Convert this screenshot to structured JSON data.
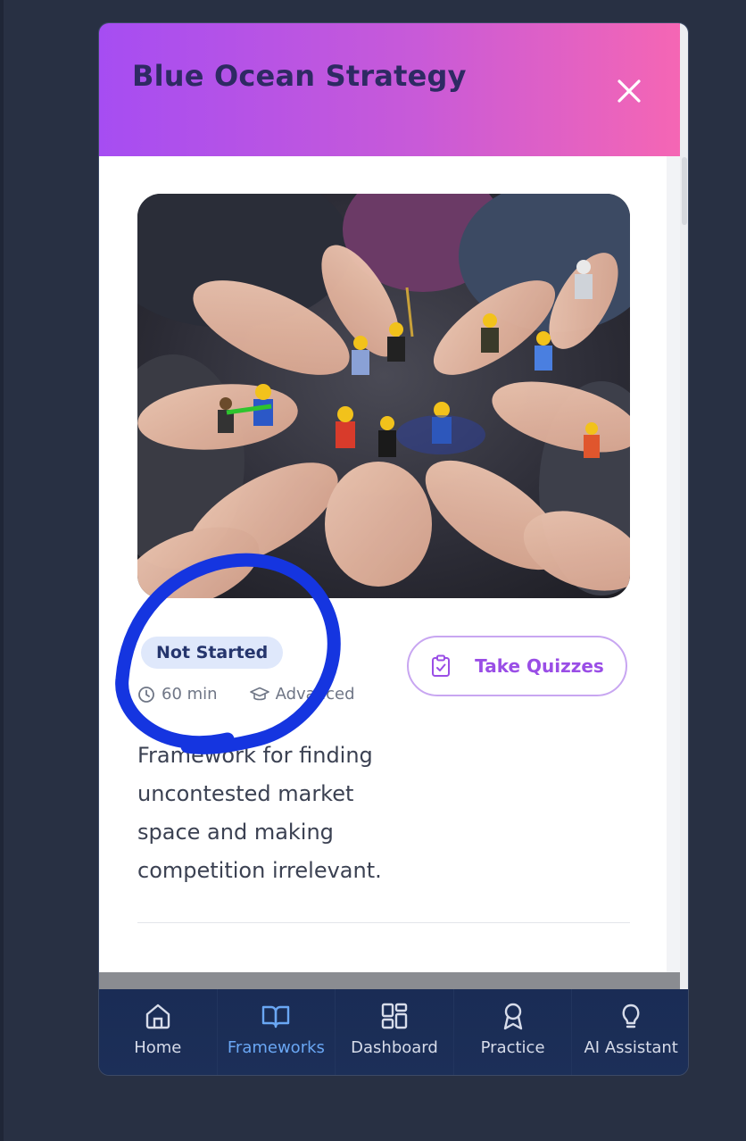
{
  "modal": {
    "title": "Blue Ocean Strategy",
    "close_icon": "close-icon"
  },
  "framework": {
    "status": "Not Started",
    "duration": "60 min",
    "level": "Advanced",
    "quiz_button_label": "Take Quizzes",
    "quiz_icon": "clipboard-check-icon",
    "description": "Framework for finding uncontested market space and making competition irrelevant.",
    "image_alt": "Hands holding toy minifigures in a circle"
  },
  "nav": {
    "items": [
      {
        "label": "Home",
        "icon": "home-icon"
      },
      {
        "label": "Frameworks",
        "icon": "book-open-icon",
        "active": true
      },
      {
        "label": "Dashboard",
        "icon": "layout-grid-icon"
      },
      {
        "label": "Practice",
        "icon": "award-icon"
      },
      {
        "label": "AI Assistant",
        "icon": "lightbulb-icon"
      }
    ]
  },
  "colors": {
    "header_gradient_start": "#a64df2",
    "header_gradient_end": "#f566b4",
    "accent_purple": "#9a4ee6",
    "nav_active": "#6aa7f4",
    "nav_background": "#1a2c55",
    "annotation_blue": "#1535e0"
  }
}
